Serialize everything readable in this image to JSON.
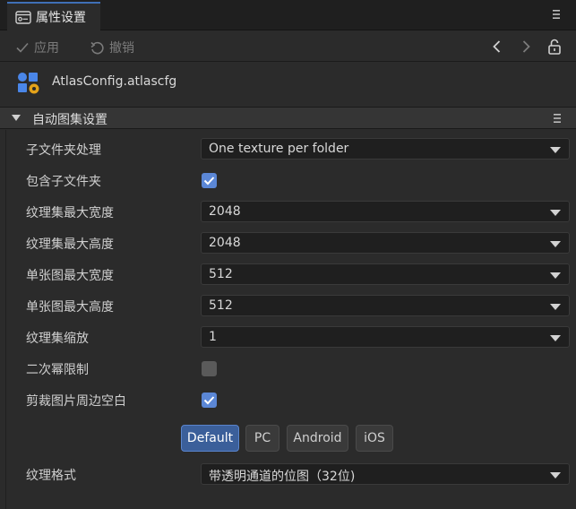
{
  "tab": {
    "title": "属性设置",
    "icon": "properties-panel-icon",
    "menu_icon": "menu-icon"
  },
  "toolbar": {
    "apply_label": "应用",
    "undo_label": "撤销"
  },
  "file": {
    "name": "AtlasConfig.atlascfg",
    "icon": "atlas-config-icon"
  },
  "section": {
    "title": "自动图集设置"
  },
  "fields": {
    "subfolder_handling": {
      "label": "子文件夹处理",
      "value": "One texture per folder"
    },
    "include_subfolders": {
      "label": "包含子文件夹",
      "checked": true
    },
    "max_atlas_width": {
      "label": "纹理集最大宽度",
      "value": "2048"
    },
    "max_atlas_height": {
      "label": "纹理集最大高度",
      "value": "2048"
    },
    "max_sprite_width": {
      "label": "单张图最大宽度",
      "value": "512"
    },
    "max_sprite_height": {
      "label": "单张图最大高度",
      "value": "512"
    },
    "atlas_scale": {
      "label": "纹理集缩放",
      "value": "1"
    },
    "power_of_two": {
      "label": "二次幂限制",
      "checked": false
    },
    "trim_whitespace": {
      "label": "剪裁图片周边空白",
      "checked": true
    },
    "texture_format": {
      "label": "纹理格式",
      "value": "带透明通道的位图（32位)"
    }
  },
  "platforms": {
    "default": "Default",
    "pc": "PC",
    "android": "Android",
    "ios": "iOS",
    "active": "Default"
  },
  "colors": {
    "accent": "#5b87d6",
    "active_tab_border": "#3f6fb6",
    "active_button": "#3b5f9a"
  }
}
